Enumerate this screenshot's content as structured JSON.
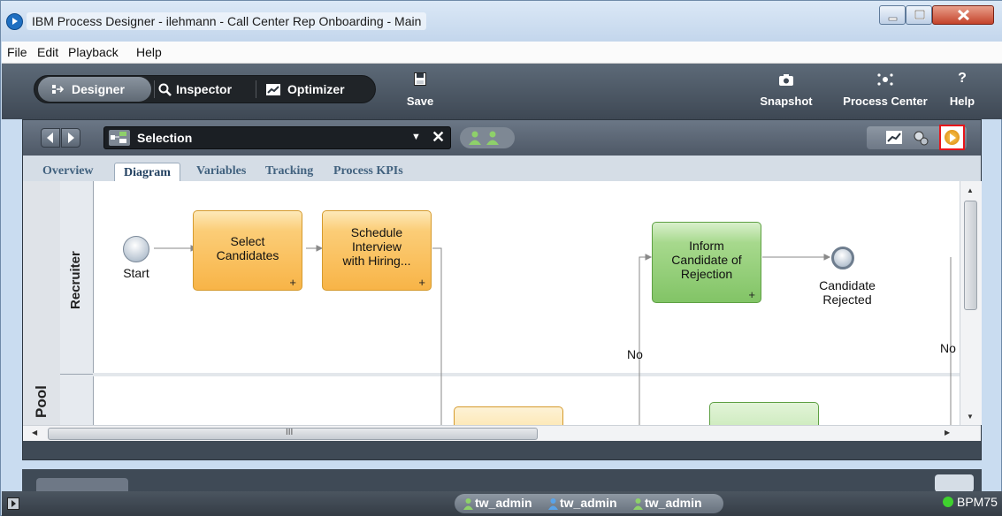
{
  "window": {
    "title": "IBM Process Designer -  ilehmann - Call Center Rep Onboarding - Main"
  },
  "menu": [
    "File",
    "Edit",
    "Playback",
    "Help"
  ],
  "toolbar": {
    "modes": [
      "Designer",
      "Inspector",
      "Optimizer"
    ],
    "save_label": "Save",
    "snapshot_label": "Snapshot",
    "process_center_label": "Process Center",
    "help_label": "Help",
    "help_glyph": "?"
  },
  "editor": {
    "process_name": "Selection",
    "tabs": [
      "Overview",
      "Diagram",
      "Variables",
      "Tracking",
      "Process KPIs"
    ],
    "active_tab": "Diagram"
  },
  "diagram": {
    "pool_label": "Pool",
    "lanes": [
      "Recruiter"
    ],
    "start_label": "Start",
    "tasks": {
      "select_candidates": "Select\nCandidates",
      "schedule_interview": "Schedule\nInterview\nwith Hiring...",
      "inform_rejection": "Inform\nCandidate of\nRejection"
    },
    "end_label": "Candidate\nRejected",
    "flow_labels": {
      "no_1": "No",
      "no_2": "No"
    },
    "hscroll_grip": "III",
    "task_marker": "+"
  },
  "status": {
    "users": [
      "tw_admin",
      "tw_admin",
      "tw_admin"
    ],
    "server": "BPM75"
  },
  "colors": {
    "task_orange": "#f8b447",
    "task_green": "#82c466",
    "run_highlight": "#e8141a"
  }
}
